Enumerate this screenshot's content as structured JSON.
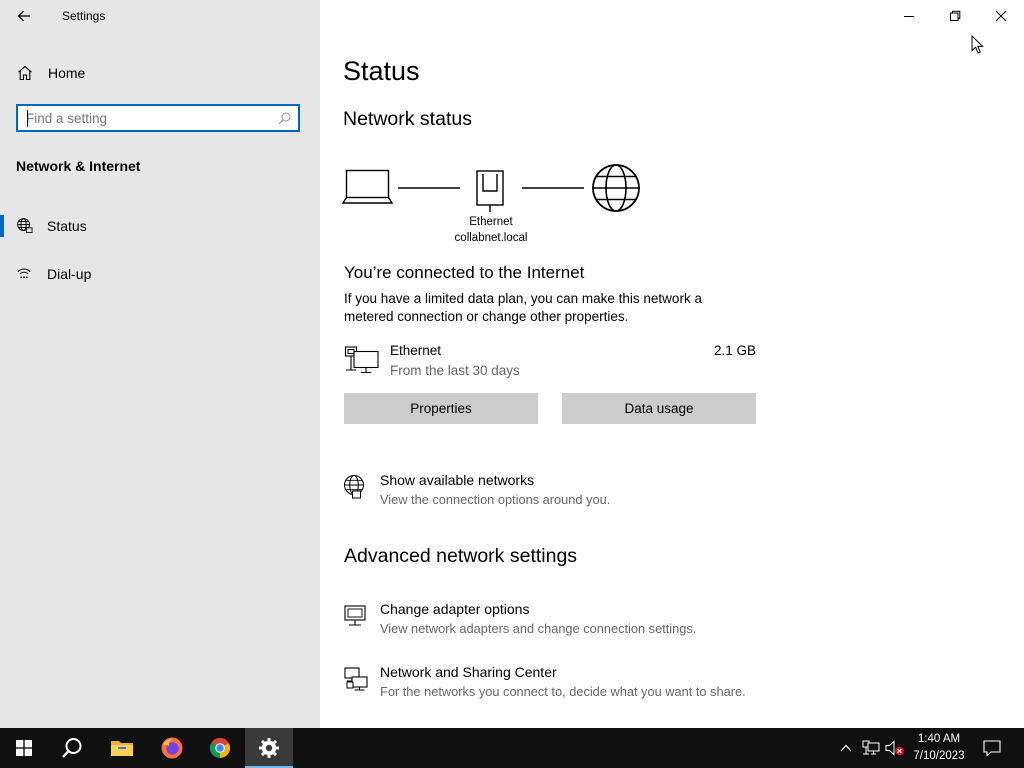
{
  "app": {
    "title": "Settings"
  },
  "sidebar": {
    "home_label": "Home",
    "search_placeholder": "Find a setting",
    "section_title": "Network & Internet",
    "items": [
      {
        "label": "Status",
        "icon": "globe-icon",
        "active": true
      },
      {
        "label": "Dial-up",
        "icon": "dial-up-icon",
        "active": false
      }
    ]
  },
  "main": {
    "title": "Status",
    "network_status_title": "Network status",
    "adapter": {
      "name": "Ethernet",
      "domain": "collabnet.local"
    },
    "connected_title": "You’re connected to the Internet",
    "connected_desc": "If you have a limited data plan, you can make this network a metered connection or change other properties.",
    "connection": {
      "name": "Ethernet",
      "period": "From the last 30 days",
      "usage": "2.1 GB"
    },
    "buttons": {
      "properties": "Properties",
      "data_usage": "Data usage"
    },
    "show_networks": {
      "title": "Show available networks",
      "desc": "View the connection options around you."
    },
    "advanced_title": "Advanced network settings",
    "adapter_options": {
      "title": "Change adapter options",
      "desc": "View network adapters and change connection settings."
    },
    "sharing_center": {
      "title": "Network and Sharing Center",
      "desc": "For the networks you connect to, decide what you want to share."
    }
  },
  "taskbar": {
    "apps": [
      "start-icon",
      "search-icon",
      "file-explorer-icon",
      "firefox-icon",
      "chrome-icon",
      "settings-icon"
    ],
    "time": "1:40 AM",
    "date": "7/10/2023"
  },
  "colors": {
    "accent": "#0067c0",
    "sidebar_bg": "#e6e6e6",
    "button_bg": "#cccccc",
    "taskbar_bg": "#101010"
  }
}
